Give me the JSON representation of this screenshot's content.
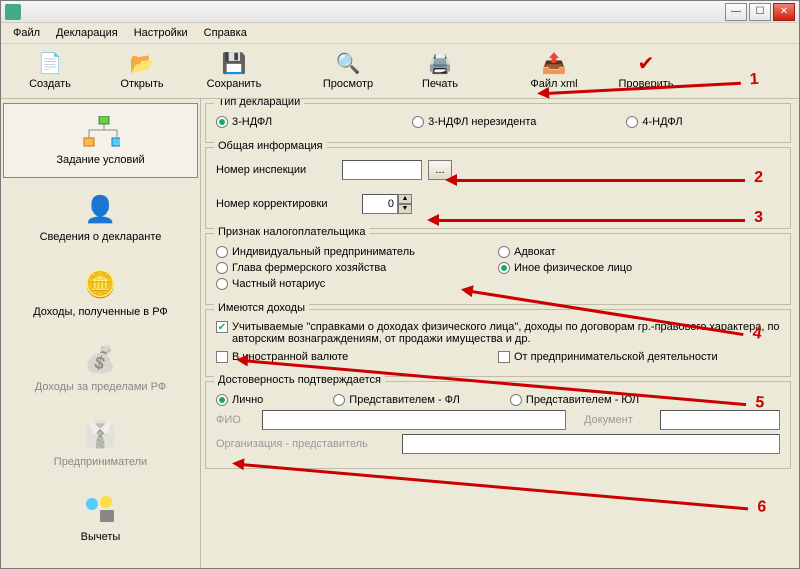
{
  "title": " ",
  "menu": {
    "file": "Файл",
    "decl": "Декларация",
    "settings": "Настройки",
    "help": "Справка"
  },
  "toolbar": {
    "create": "Создать",
    "open": "Открыть",
    "save": "Сохранить",
    "preview": "Просмотр",
    "print": "Печать",
    "xml": "Файл xml",
    "check": "Проверить"
  },
  "sidebar": {
    "items": [
      {
        "label": "Задание условий"
      },
      {
        "label": "Сведения о декларанте"
      },
      {
        "label": "Доходы, полученные в РФ"
      },
      {
        "label": "Доходы за пределами РФ"
      },
      {
        "label": "Предприниматели"
      },
      {
        "label": "Вычеты"
      }
    ]
  },
  "decl_type": {
    "title": "Тип декларации",
    "opts": {
      "a": "3-НДФЛ",
      "b": "3-НДФЛ нерезидента",
      "c": "4-НДФЛ"
    }
  },
  "general": {
    "title": "Общая информация",
    "insp_label": "Номер инспекции",
    "insp_btn": "...",
    "corr_label": "Номер корректировки",
    "corr_value": "0"
  },
  "taxpayer": {
    "title": "Признак налогоплательщика",
    "a": "Индивидуальный предприниматель",
    "b": "Глава фермерского хозяйства",
    "c": "Частный нотариус",
    "d": "Адвокат",
    "e": "Иное физическое лицо"
  },
  "income": {
    "title": "Имеются доходы",
    "a": "Учитываемые \"справками о доходах физического лица\", доходы по договорам гр.-правового характера, по авторским вознаграждениям, от продажи имущества и др.",
    "b": "В иностранной валюте",
    "c": "От предпринимательской деятельности"
  },
  "confirm": {
    "title": "Достоверность подтверждается",
    "a": "Лично",
    "b": "Представителем - ФЛ",
    "c": "Представителем - ЮЛ",
    "fio": "ФИО",
    "doc": "Документ",
    "org": "Организация - представитель"
  },
  "annotations": {
    "n1": "1",
    "n2": "2",
    "n3": "3",
    "n4": "4",
    "n5": "5",
    "n6": "6"
  }
}
